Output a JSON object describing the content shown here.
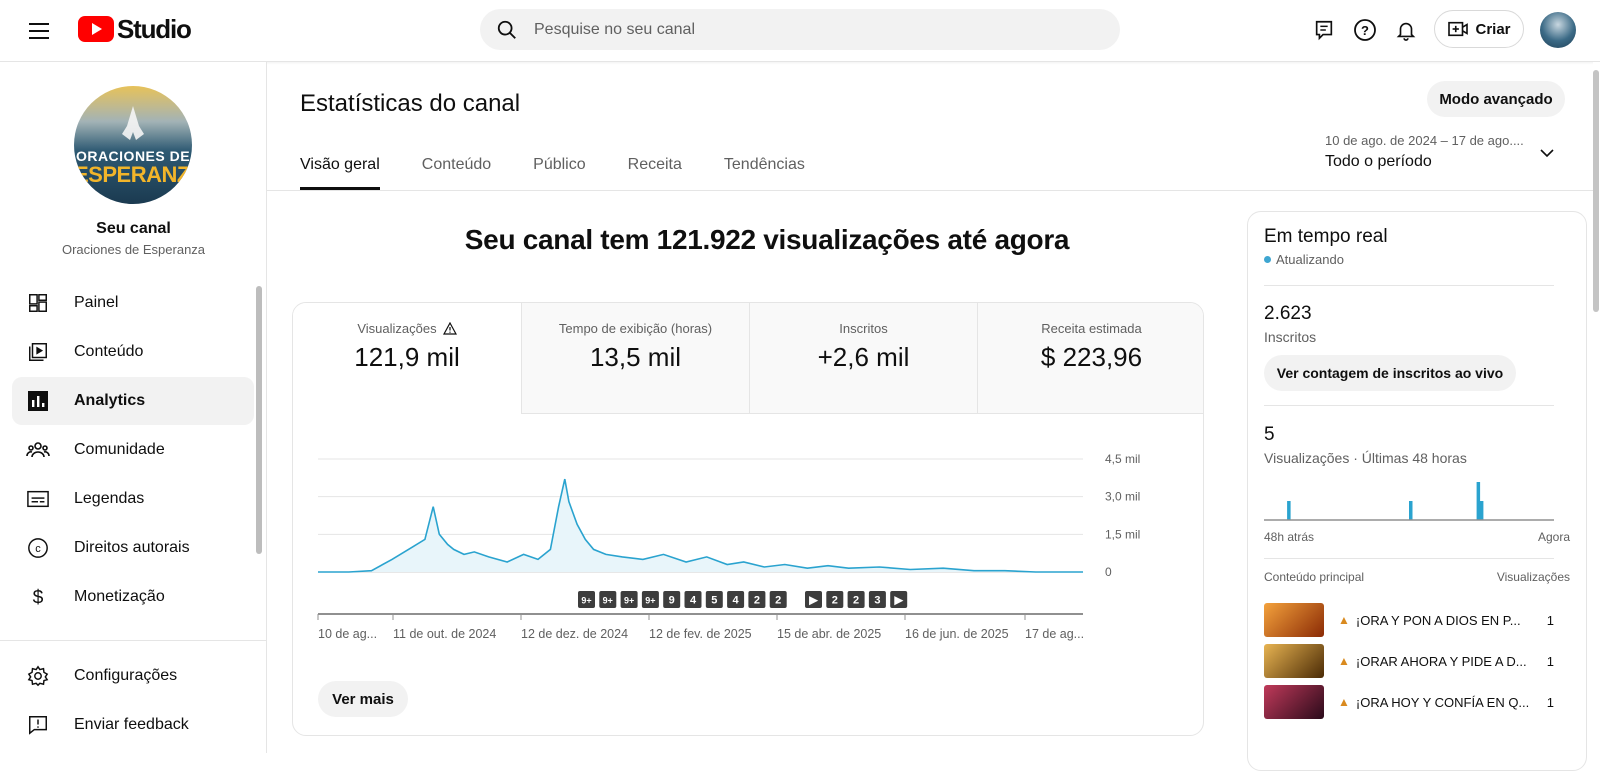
{
  "app": {
    "logo_text": "Studio",
    "search_placeholder": "Pesquise no seu canal",
    "create_label": "Criar"
  },
  "sidebar": {
    "channel_title": "Seu canal",
    "channel_name": "Oraciones de Esperanza",
    "avatar_line1": "ORACIONES DE",
    "avatar_line2": "ESPERANZA",
    "items": [
      {
        "label": "Painel",
        "icon": "dashboard-icon"
      },
      {
        "label": "Conteúdo",
        "icon": "content-icon"
      },
      {
        "label": "Analytics",
        "icon": "analytics-icon",
        "active": true
      },
      {
        "label": "Comunidade",
        "icon": "community-icon"
      },
      {
        "label": "Legendas",
        "icon": "subtitles-icon"
      },
      {
        "label": "Direitos autorais",
        "icon": "copyright-icon"
      },
      {
        "label": "Monetização",
        "icon": "monetization-icon"
      }
    ],
    "bottom_items": [
      {
        "label": "Configurações",
        "icon": "settings-icon"
      },
      {
        "label": "Enviar feedback",
        "icon": "feedback-icon"
      }
    ]
  },
  "main": {
    "page_title": "Estatísticas do canal",
    "advanced_mode": "Modo avançado",
    "tabs": [
      "Visão geral",
      "Conteúdo",
      "Público",
      "Receita",
      "Tendências"
    ],
    "date_range": "10 de ago. de 2024 – 17 de ago....",
    "period": "Todo o período",
    "headline": "Seu canal tem 121.922 visualizações até agora",
    "metrics": [
      {
        "label": "Visualizações",
        "value": "121,9 mil"
      },
      {
        "label": "Tempo de exibição (horas)",
        "value": "13,5 mil"
      },
      {
        "label": "Inscritos",
        "value": "+2,6 mil"
      },
      {
        "label": "Receita estimada",
        "value": "$ 223,96"
      }
    ],
    "see_more": "Ver mais"
  },
  "chart_data": {
    "type": "area",
    "title": "",
    "ylabel": "",
    "y_ticks": [
      "4,5 mil",
      "3,0 mil",
      "1,5 mil",
      "0"
    ],
    "y_tick_values": [
      4500,
      3000,
      1500,
      0
    ],
    "ylim": [
      0,
      4500
    ],
    "x_tick_labels": [
      "10 de ag...",
      "11 de out. de 2024",
      "12 de dez. de 2024",
      "12 de fev. de 2025",
      "15 de abr. de 2025",
      "16 de jun. de 2025",
      "17 de ag..."
    ],
    "color": "#2aa3cf",
    "x": [
      "2024-08-10",
      "2024-08-25",
      "2024-09-05",
      "2024-09-15",
      "2024-09-25",
      "2024-10-01",
      "2024-10-05",
      "2024-10-08",
      "2024-10-12",
      "2024-10-15",
      "2024-10-20",
      "2024-10-25",
      "2024-11-01",
      "2024-11-10",
      "2024-11-18",
      "2024-11-25",
      "2024-12-01",
      "2024-12-05",
      "2024-12-08",
      "2024-12-10",
      "2024-12-14",
      "2024-12-18",
      "2024-12-22",
      "2024-12-28",
      "2025-01-05",
      "2025-01-15",
      "2025-01-25",
      "2025-02-05",
      "2025-02-15",
      "2025-02-25",
      "2025-03-05",
      "2025-03-15",
      "2025-03-25",
      "2025-04-05",
      "2025-04-15",
      "2025-04-25",
      "2025-05-10",
      "2025-05-25",
      "2025-06-10",
      "2025-06-25",
      "2025-07-10",
      "2025-07-25",
      "2025-08-10",
      "2025-08-17"
    ],
    "values": [
      0,
      0,
      50,
      500,
      1000,
      1300,
      2600,
      1500,
      1100,
      900,
      700,
      800,
      600,
      400,
      700,
      500,
      900,
      2600,
      3700,
      2800,
      1900,
      1300,
      900,
      700,
      600,
      500,
      700,
      400,
      600,
      300,
      400,
      200,
      300,
      150,
      250,
      150,
      200,
      100,
      150,
      50,
      50,
      0,
      0,
      0
    ],
    "annotations": [
      "9+",
      "9+",
      "9+",
      "9+",
      "9",
      "4",
      "5",
      "4",
      "2",
      "2",
      "▶",
      "2",
      "2",
      "3",
      "▶"
    ]
  },
  "realtime": {
    "title": "Em tempo real",
    "status": "Atualizando",
    "subscribers_value": "2.623",
    "subscribers_label": "Inscritos",
    "live_count_button": "Ver contagem de inscritos ao vivo",
    "views_value": "5",
    "views_label": "Visualizações · Últimas 48 horas",
    "axis_start": "48h atrás",
    "axis_end": "Agora",
    "bars": [
      0,
      0,
      0,
      0,
      0,
      0,
      0,
      0,
      0,
      0,
      0,
      0,
      0,
      0,
      1,
      0,
      0,
      0,
      0,
      0,
      0,
      0,
      0,
      0,
      0,
      0,
      0,
      0,
      0,
      0,
      0,
      0,
      0,
      0,
      0,
      0,
      0,
      0,
      0,
      0,
      0,
      0,
      0,
      0,
      0,
      0,
      0,
      0,
      0,
      0,
      0,
      0,
      0,
      0,
      0,
      0,
      0,
      0,
      0,
      0,
      0,
      0,
      0,
      0,
      0,
      0,
      0,
      0,
      0,
      0,
      0,
      0,
      0,
      0,
      0,
      0,
      0,
      0,
      0,
      0,
      0,
      0,
      0,
      0,
      0,
      0,
      0,
      0,
      1,
      0,
      0,
      0,
      0,
      0,
      0,
      0,
      0,
      0,
      0,
      0,
      0,
      0,
      0,
      0,
      0,
      0,
      0,
      0,
      0,
      0,
      0,
      0,
      0,
      0,
      0,
      0,
      0,
      0,
      0,
      0,
      0,
      0,
      0,
      0,
      0,
      0,
      0,
      0,
      0,
      2,
      0,
      1,
      0,
      0,
      0,
      0,
      0,
      0,
      0,
      0,
      0,
      0,
      0,
      0,
      0,
      0,
      0,
      0,
      0,
      0,
      0,
      0,
      0,
      0,
      0,
      0,
      0,
      0,
      0,
      0,
      0,
      0,
      0,
      0,
      0,
      0,
      0,
      0,
      0,
      0,
      0,
      0,
      0,
      0,
      0,
      0
    ],
    "top_content_label": "Conteúdo principal",
    "views_column_label": "Visualizações",
    "top_content": [
      {
        "title": "¡ORA Y PON A DIOS EN P...",
        "views": "1",
        "thumb": "#c75a12"
      },
      {
        "title": "¡ORAR AHORA Y PIDE A D...",
        "views": "1",
        "thumb": "#8a5a12"
      },
      {
        "title": "¡ORA HOY Y CONFÍA EN Q...",
        "views": "1",
        "thumb": "#7a1e3a"
      }
    ]
  }
}
